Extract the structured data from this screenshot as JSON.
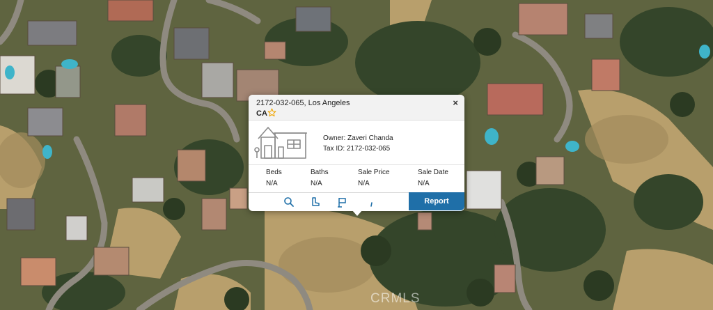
{
  "popup": {
    "address_line1": "2172-032-065, Los Angeles",
    "address_line2": "CA",
    "close_glyph": "×",
    "owner_label": "Owner:",
    "owner_value": "Zaveri Chanda",
    "taxid_label": "Tax ID:",
    "taxid_value": "2172-032-065",
    "stats": [
      {
        "label": "Beds",
        "value": "N/A"
      },
      {
        "label": "Baths",
        "value": "N/A"
      },
      {
        "label": "Sale Price",
        "value": "N/A"
      },
      {
        "label": "Sale Date",
        "value": "N/A"
      }
    ],
    "tools": [
      "search-icon",
      "boot-icon",
      "flag-icon",
      "measure-icon"
    ],
    "report_label": "Report"
  },
  "watermark": "CRMLS",
  "colors": {
    "accent": "#1f6fa8",
    "star": "#f0a500",
    "map_dry": "#b59a68",
    "map_tree": "#3c4a2a"
  }
}
